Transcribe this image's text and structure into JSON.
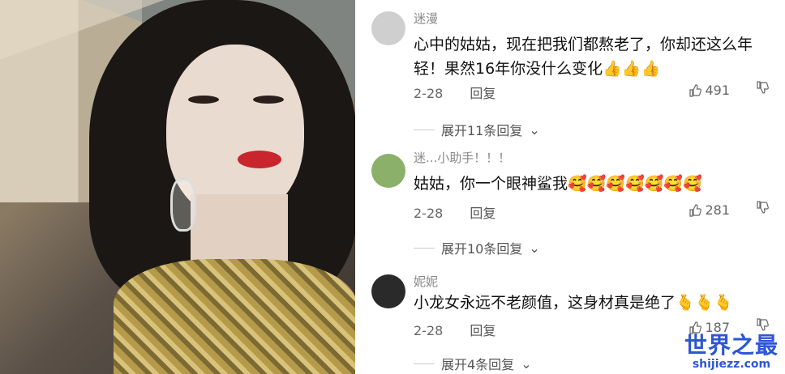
{
  "comments": [
    {
      "username": "迷漫",
      "text": "心中的姑姑，现在把我们都熬老了，你却还这么年轻！果然16年你没什么变化👍👍👍",
      "date": "2-28",
      "reply": "回复",
      "likes": "491",
      "expand": "展开11条回复",
      "avatar_color": "#cfcfcf"
    },
    {
      "username": "迷...小助手！！！",
      "text": "姑姑，你一个眼神鲨我🥰🥰🥰🥰🥰🥰🥰",
      "date": "2-28",
      "reply": "回复",
      "likes": "281",
      "expand": "展开10条回复",
      "avatar_color": "#8ab06a"
    },
    {
      "username": "妮妮",
      "text": "小龙女永远不老颜值，这身材真是绝了🫰🫰🫰",
      "date": "2-28",
      "reply": "回复",
      "likes": "187",
      "expand": "展开4条回复",
      "avatar_color": "#2a2a2a"
    }
  ],
  "watermark": {
    "line1": "世界之最",
    "line2": "shijiezz.com"
  }
}
